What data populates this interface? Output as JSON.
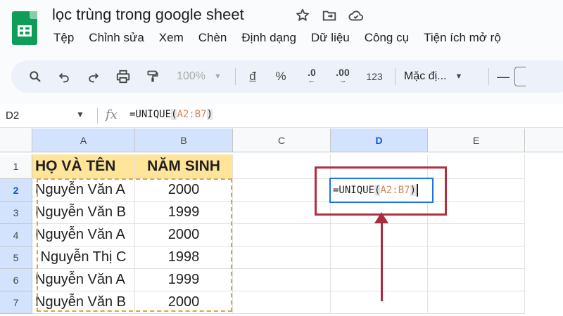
{
  "doc": {
    "title": "lọc trùng trong google sheet"
  },
  "menu": [
    "Tệp",
    "Chỉnh sửa",
    "Xem",
    "Chèn",
    "Định dạng",
    "Dữ liệu",
    "Công cụ",
    "Tiện ích mở rộ"
  ],
  "toolbar": {
    "zoom": "100%",
    "currency": "đ",
    "percent": "%",
    "dec_decrease": ".0",
    "dec_increase": ".00",
    "number_format": "123",
    "font": "Mặc đị...",
    "minus": "—"
  },
  "formula_bar": {
    "name_box": "D2",
    "fx": "fx",
    "fn_open": "=UNIQUE",
    "paren_open": "(",
    "range": "A2:B7",
    "paren_close": ")"
  },
  "columns": [
    "A",
    "B",
    "C",
    "D",
    "E"
  ],
  "rows": [
    "1",
    "2",
    "3",
    "4",
    "5",
    "6",
    "7"
  ],
  "header_row": {
    "a": "HỌ VÀ TÊN",
    "b": "NĂM SINH"
  },
  "data_rows": [
    {
      "a": "Nguyễn Văn A",
      "b": "2000"
    },
    {
      "a": "Nguyễn Văn B",
      "b": "1999"
    },
    {
      "a": "Nguyễn Văn A",
      "b": "2000"
    },
    {
      "a": "Nguyễn Thị C",
      "b": "1998"
    },
    {
      "a": "Nguyễn Văn A",
      "b": "1999"
    },
    {
      "a": "Nguyễn Văn B",
      "b": "2000"
    }
  ],
  "active_cell": {
    "fn_open": "=UNIQUE",
    "paren_open": "(",
    "range": "A2:B7",
    "paren_close": ")"
  },
  "colors": {
    "header_fill": "#ffe599",
    "selection_border": "#e2a23b",
    "active_border": "#1a73e8",
    "annotation": "#a82c40"
  }
}
